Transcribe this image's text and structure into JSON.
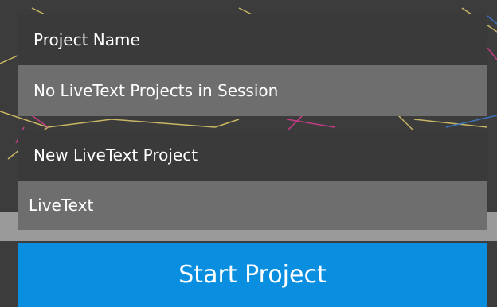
{
  "project_name_header": "Project Name",
  "existing_projects": "No LiveText Projects in Session",
  "new_project_header": "New LiveText Project",
  "new_project_input": {
    "value": "LiveText"
  },
  "start_button": "Start Project",
  "colors": {
    "background": "#3c3c3c",
    "header": "#3a3a3a",
    "field": "#6e6e6e",
    "accent": "#0a8fe0",
    "line_gold": "#d8c46a",
    "line_magenta": "#d23c8c",
    "line_blue": "#3c78c8"
  }
}
